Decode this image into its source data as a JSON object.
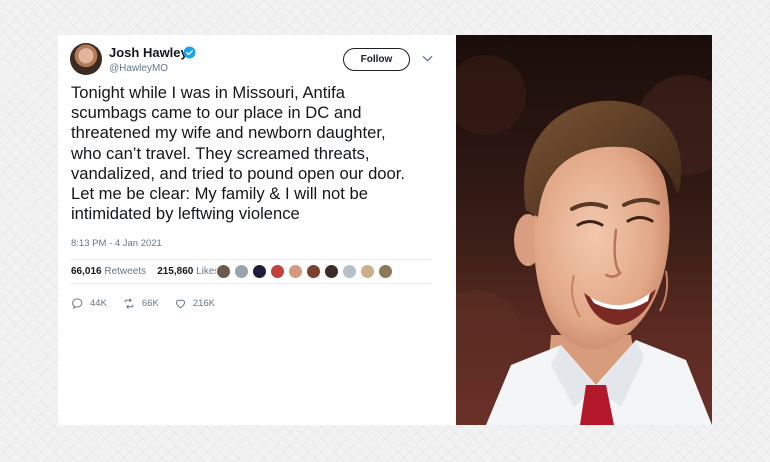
{
  "tweet": {
    "display_name": "Josh Hawley",
    "handle": "@HawleyMO",
    "follow_label": "Follow",
    "text": "Tonight while I was in Missouri, Antifa\nscumbags came to our place in DC and\nthreatened my wife and newborn daughter,\nwho can’t travel. They screamed threats,\nvandalized, and tried to pound open our door.\nLet me be clear: My family & I will not be\nintimidated by leftwing violence",
    "timestamp": "8:13 PM - 4 Jan 2021",
    "retweets_count": "66,016",
    "retweets_label": "Retweets",
    "likes_count": "215,860",
    "likes_label": "Likes",
    "reply_count": "44K",
    "retweet_action_count": "66K",
    "like_action_count": "216K",
    "liker_avatar_colors": [
      "#6b5a4e",
      "#9aa3ad",
      "#1e1e3a",
      "#c0423a",
      "#d19a7a",
      "#7a4030",
      "#3b2a25",
      "#b7bfc8",
      "#c9b08a",
      "#8a7a5a"
    ]
  },
  "photo": {
    "subject": "man in white shirt with red tie smiling",
    "colors": {
      "background": "#2a1612",
      "skin": "#e8b89c",
      "hair": "#5a3a24",
      "shirt": "#f4f5f7",
      "tie": "#b3182a"
    }
  },
  "colors": {
    "verified": "#1da1f2",
    "text": "#14171a",
    "muted": "#657786"
  }
}
